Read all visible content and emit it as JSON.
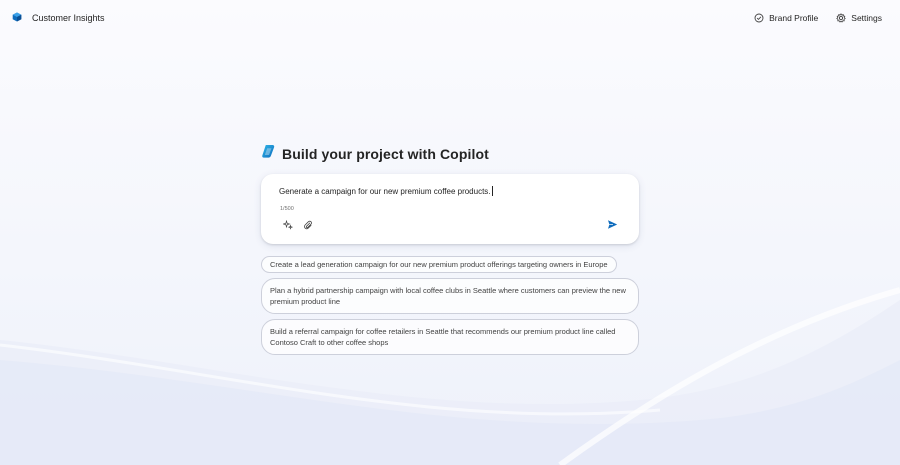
{
  "app": {
    "title": "Customer Insights",
    "logo_icon": "customer-insights-logo-icon"
  },
  "header": {
    "brand_profile_label": "Brand Profile",
    "settings_label": "Settings"
  },
  "copilot": {
    "heading": "Build your project with Copilot",
    "input_value": "Generate a campaign for our new premium coffee products.",
    "char_counter": "1/500",
    "accent_color": "#0f6cbd"
  },
  "suggestions": [
    "Create a lead generation campaign for our new premium product offerings targeting owners in Europe",
    "Plan a hybrid partnership campaign with local coffee clubs in Seattle where customers can preview the new premium product line",
    "Build a referral campaign for coffee retailers in Seattle that recommends our premium product line called Contoso Craft to other coffee shops"
  ]
}
